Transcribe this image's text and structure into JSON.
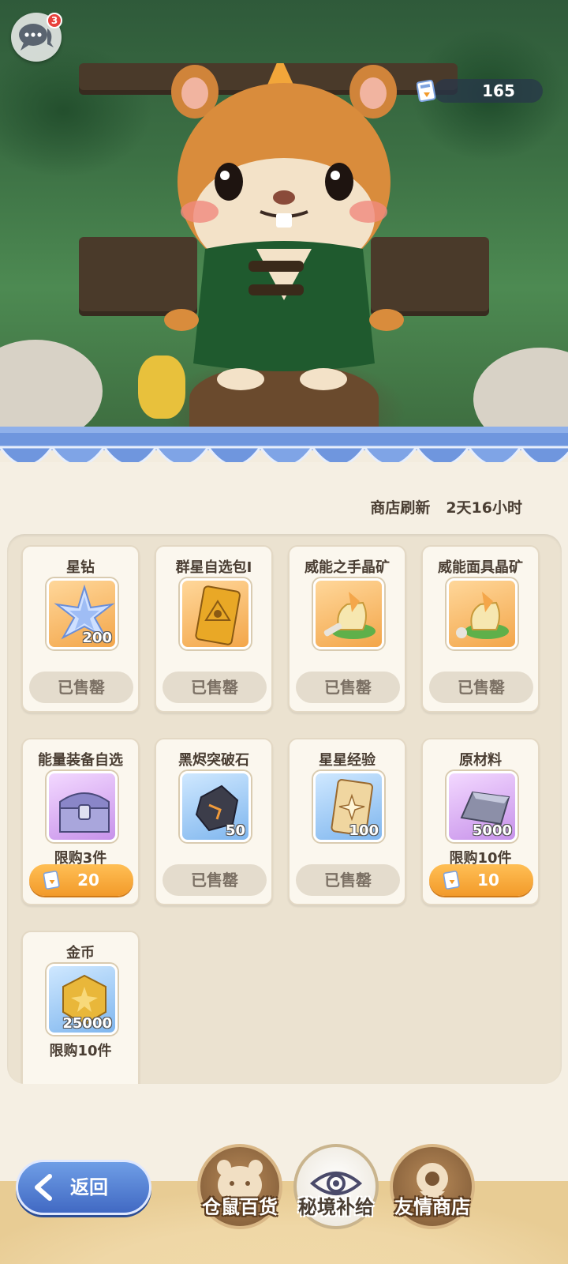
{
  "chat": {
    "badge": "3"
  },
  "currency": {
    "icon": "ticket-icon",
    "value": "165"
  },
  "shop": {
    "refresh_label": "商店刷新",
    "refresh_time": "2天16小时"
  },
  "items": [
    {
      "name": "星钻",
      "icon": "star-diamond-icon",
      "qty": "200",
      "bg": "orange",
      "limit": "",
      "status": "已售罄"
    },
    {
      "name": "群星自选包Ⅰ",
      "icon": "card-pack-icon",
      "qty": "",
      "bg": "orange",
      "limit": "",
      "status": "已售罄"
    },
    {
      "name": "威能之手晶矿",
      "icon": "crystal-ore-icon",
      "qty": "",
      "bg": "orange",
      "limit": "",
      "status": "已售罄"
    },
    {
      "name": "威能面具晶矿",
      "icon": "crystal-ore-icon",
      "qty": "",
      "bg": "orange",
      "limit": "",
      "status": "已售罄"
    },
    {
      "name": "能量装备自选",
      "icon": "treasure-chest-icon",
      "qty": "",
      "bg": "purple",
      "limit": "限购3件",
      "price": "20"
    },
    {
      "name": "黑烬突破石",
      "icon": "black-stone-icon",
      "qty": "50",
      "bg": "blue",
      "limit": "",
      "status": "已售罄"
    },
    {
      "name": "星星经验",
      "icon": "star-card-icon",
      "qty": "100",
      "bg": "blue",
      "limit": "",
      "status": "已售罄"
    },
    {
      "name": "原材料",
      "icon": "metal-ingot-icon",
      "qty": "5000",
      "bg": "purple",
      "limit": "限购10件",
      "price": "10"
    },
    {
      "name": "金币",
      "icon": "gold-coin-icon",
      "qty": "25000",
      "bg": "blue",
      "limit": "限购10件"
    }
  ],
  "nav": {
    "back": "返回",
    "tabs": [
      {
        "label": "仓鼠百货",
        "icon": "hamster-icon",
        "active": false
      },
      {
        "label": "秘境补给",
        "icon": "eye-emblem-icon",
        "active": true
      },
      {
        "label": "友情商店",
        "icon": "friend-badge-icon",
        "active": false
      }
    ]
  },
  "colors": {
    "accent_orange": "#f29a2a",
    "back_blue": "#4169c3",
    "awning_blue": "#6f96de"
  }
}
